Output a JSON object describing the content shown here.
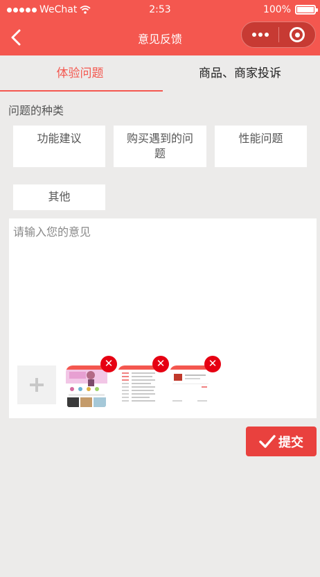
{
  "status_bar": {
    "carrier": "WeChat",
    "time": "2:53",
    "battery": "100%"
  },
  "nav": {
    "title": "意见反馈"
  },
  "tabs": [
    {
      "label": "体验问题",
      "active": true
    },
    {
      "label": "商品、商家投诉",
      "active": false
    }
  ],
  "category_label": "问题的种类",
  "categories": [
    "功能建议",
    "购买遇到的问题",
    "性能问题",
    "其他"
  ],
  "feedback": {
    "placeholder": "请输入您的意见",
    "value": ""
  },
  "thumbnails": [
    "screenshot-thumbnail-1",
    "screenshot-thumbnail-2",
    "screenshot-thumbnail-3"
  ],
  "submit_label": "提交",
  "colors": {
    "brand": "#f4574f",
    "background": "#ecebea",
    "submit": "#e9413e",
    "delete_badge": "#e60012"
  }
}
